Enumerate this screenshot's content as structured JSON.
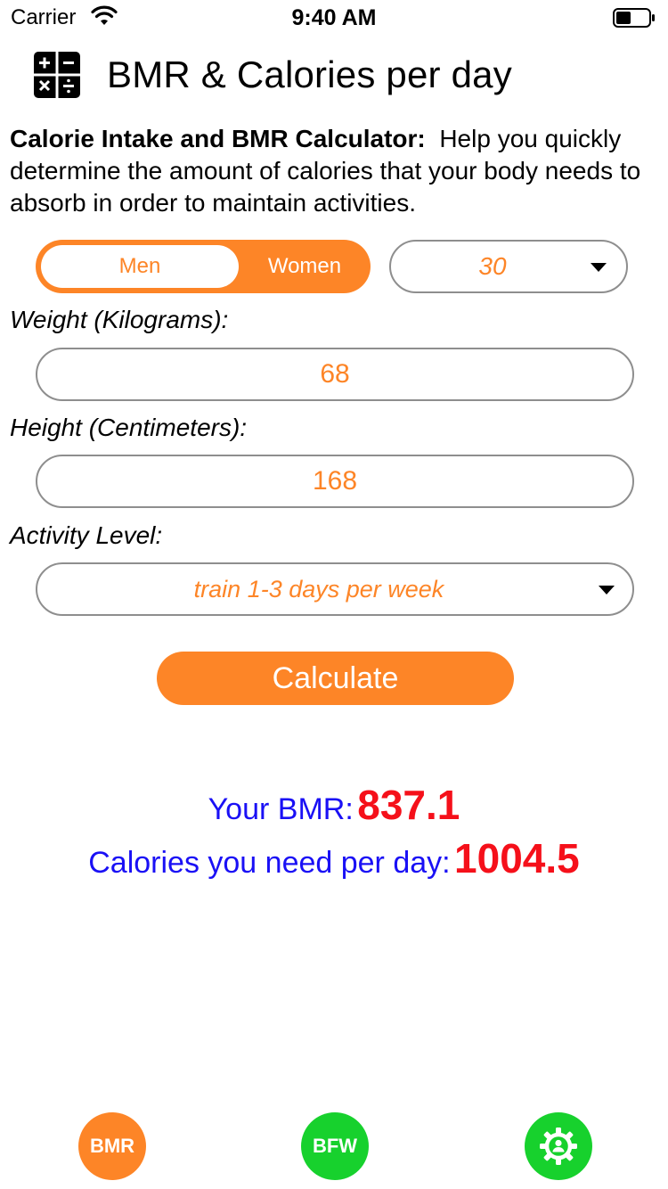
{
  "status_bar": {
    "carrier": "Carrier",
    "time": "9:40 AM",
    "icons": [
      "wifi-icon",
      "battery-icon"
    ]
  },
  "header": {
    "icon": "calculator-icon",
    "title": "BMR & Calories per day"
  },
  "intro": {
    "bold": "Calorie Intake and BMR Calculator:",
    "text": "Help you quickly determine the amount of calories that your body needs to absorb in order to maintain activities."
  },
  "gender": {
    "options": [
      "Men",
      "Women"
    ],
    "selected": "Women"
  },
  "age": {
    "value": "30"
  },
  "weight": {
    "label": "Weight (Kilograms):",
    "value": "68"
  },
  "height": {
    "label": "Height (Centimeters):",
    "value": "168"
  },
  "activity": {
    "label": "Activity Level:",
    "value": "train 1-3 days per week"
  },
  "calculate_label": "Calculate",
  "results": {
    "bmr_label": "Your BMR:",
    "bmr_value": "837.1",
    "calories_label": "Calories you need per day:",
    "calories_value": "1004.5"
  },
  "tabs": {
    "bmr": "BMR",
    "bfw": "BFW",
    "settings_icon": "gear-icon"
  },
  "colors": {
    "accent": "#fd8527",
    "tab_green": "#17d12d",
    "result_label": "#1a10f5",
    "result_value": "#f5101a"
  }
}
